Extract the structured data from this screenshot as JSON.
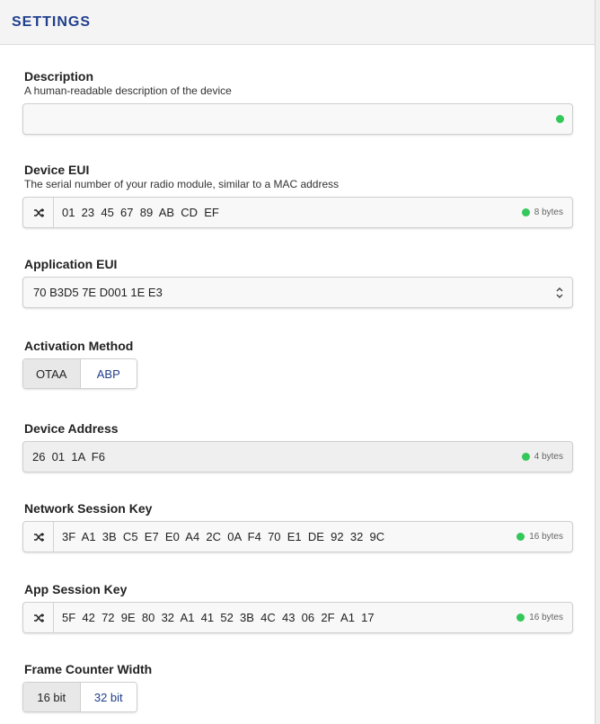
{
  "header": {
    "title": "SETTINGS"
  },
  "description": {
    "label": "Description",
    "help": "A human-readable description of the device",
    "value": "",
    "valid_color": "#34c759"
  },
  "device_eui": {
    "label": "Device EUI",
    "help": "The serial number of your radio module, similar to a MAC address",
    "value": "01  23  45  67  89  AB  CD  EF",
    "size": "8 bytes",
    "icon": "shuffle-icon"
  },
  "application_eui": {
    "label": "Application EUI",
    "value": "70 B3D5 7E D001 1E E3",
    "icon": "select-arrows-icon"
  },
  "activation_method": {
    "label": "Activation Method",
    "options": [
      "OTAA",
      "ABP"
    ],
    "selected": "OTAA"
  },
  "device_address": {
    "label": "Device Address",
    "value": "26  01  1A  F6",
    "size": "4 bytes"
  },
  "network_session_key": {
    "label": "Network Session Key",
    "value": "3F  A1  3B  C5  E7  E0  A4  2C  0A  F4  70  E1  DE  92  32  9C",
    "size": "16 bytes",
    "icon": "shuffle-icon"
  },
  "app_session_key": {
    "label": "App Session Key",
    "value": "5F  42  72  9E  80  32  A1  41  52  3B  4C  43  06  2F  A1  17",
    "size": "16 bytes",
    "icon": "shuffle-icon"
  },
  "frame_counter_width": {
    "label": "Frame Counter Width",
    "options": [
      "16 bit",
      "32 bit"
    ],
    "selected": "16 bit"
  },
  "colors": {
    "accent": "#1f3e8c",
    "valid": "#34c759"
  }
}
